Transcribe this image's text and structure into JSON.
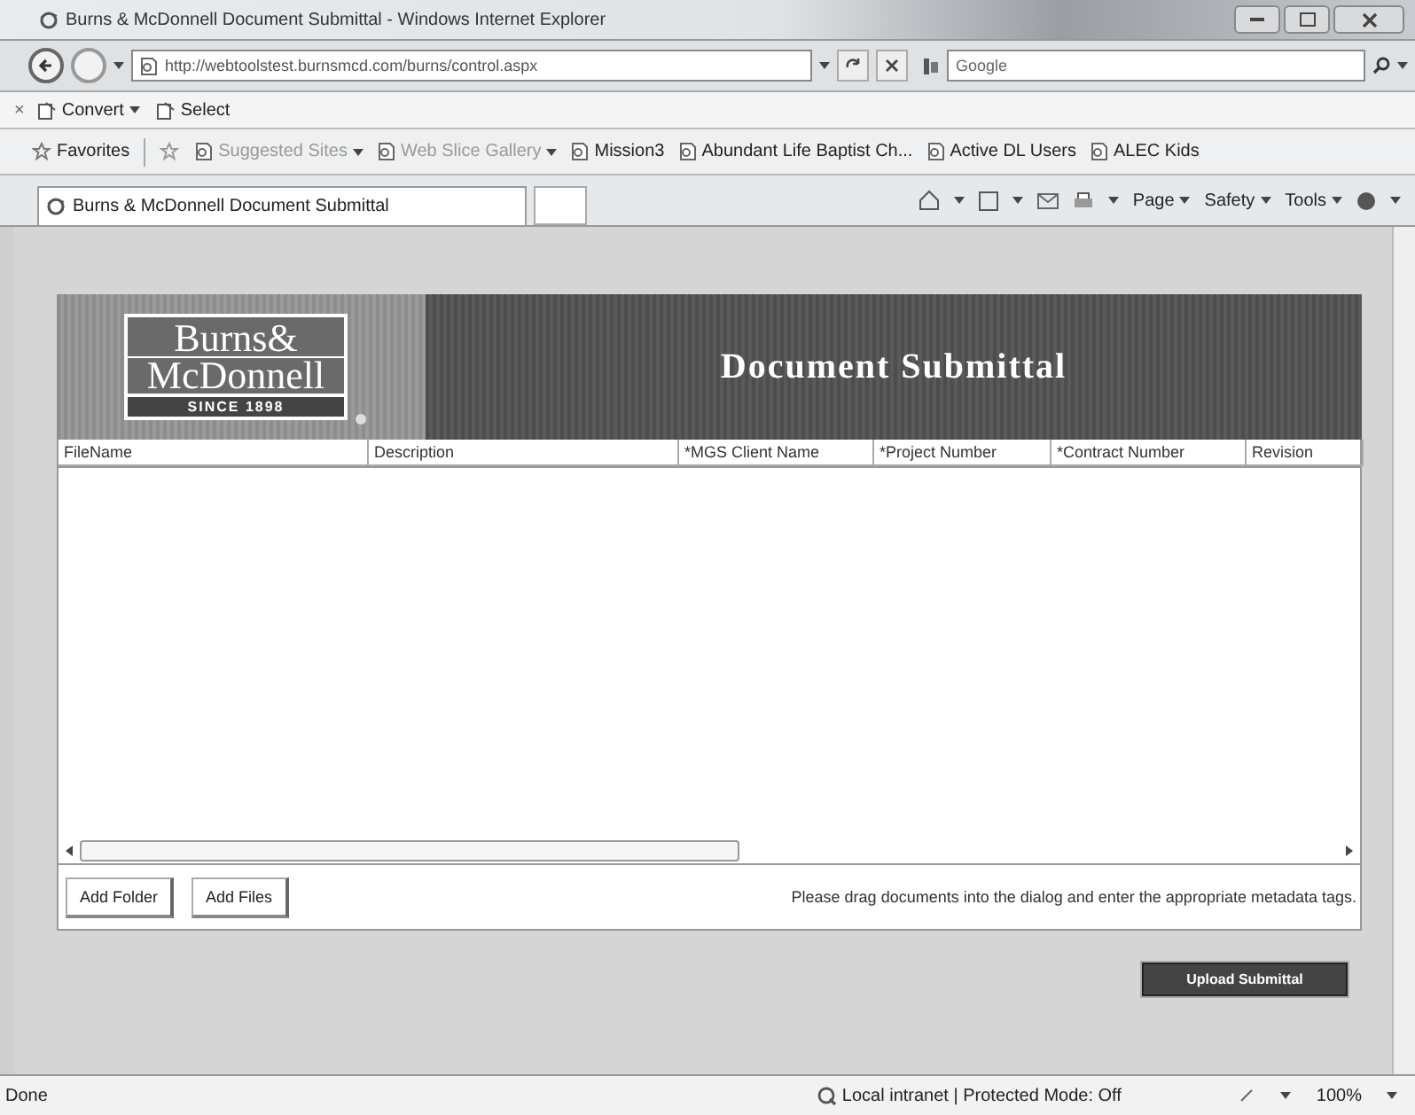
{
  "window": {
    "title": "Burns & McDonnell Document Submittal - Windows Internet Explorer"
  },
  "address_bar": {
    "url": "http://webtoolstest.burnsmcd.com/burns/control.aspx"
  },
  "search": {
    "placeholder": "Google"
  },
  "convert_bar": {
    "close": "×",
    "items": [
      {
        "label": "Convert",
        "dropdown": true
      },
      {
        "label": "Select",
        "dropdown": false
      }
    ]
  },
  "favorites_bar": {
    "items": [
      {
        "label": "Favorites",
        "dropdown": false,
        "disabled": false
      },
      {
        "label": "Suggested Sites",
        "dropdown": true,
        "disabled": true
      },
      {
        "label": "Web Slice Gallery",
        "dropdown": true,
        "disabled": true
      },
      {
        "label": "Mission3",
        "dropdown": false,
        "disabled": false
      },
      {
        "label": "Abundant Life Baptist Ch...",
        "dropdown": false,
        "disabled": false
      },
      {
        "label": "Active DL Users",
        "dropdown": false,
        "disabled": false
      },
      {
        "label": "ALEC Kids",
        "dropdown": false,
        "disabled": false
      }
    ]
  },
  "tab": {
    "title": "Burns & McDonnell Document Submittal"
  },
  "command_bar": {
    "items": [
      "Page",
      "Safety",
      "Tools"
    ]
  },
  "page": {
    "logo": {
      "name": "Burns&",
      "name_2": "McDonnell",
      "tagline": "SINCE 1898"
    },
    "heading": "Document Submittal",
    "columns": [
      "FileName",
      "Description",
      "*MGS Client Name",
      "*Project Number",
      "*Contract Number",
      "Revision"
    ],
    "buttons": [
      "Add Folder",
      "Add Files"
    ],
    "hint": "Please drag documents into the dialog and enter the appropriate metadata tags.",
    "submit": "Upload Submittal"
  },
  "status_bar": {
    "status": "Done",
    "zone": "Local intranet | Protected Mode: Off",
    "zoom": "100%"
  }
}
